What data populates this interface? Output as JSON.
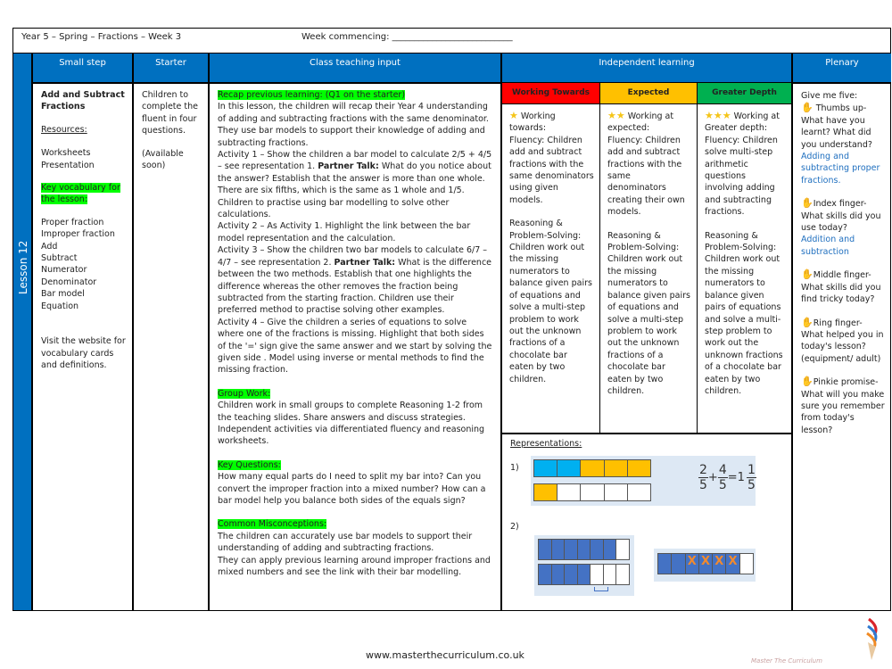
{
  "header": {
    "title": "Year 5 – Spring – Fractions – Week 3",
    "week_commencing": "Week commencing: ___________________________"
  },
  "lesson_label": "Lesson 12",
  "columns": [
    "Small step",
    "Starter",
    "Class teaching input",
    "Independent learning",
    "Plenary"
  ],
  "small_step": {
    "title": "Add and Subtract Fractions",
    "resources_label": "Resources:",
    "resources": [
      "Worksheets",
      "Presentation"
    ],
    "vocab_label": "Key vocabulary for the lesson:",
    "vocab": [
      "Proper fraction",
      "Improper fraction",
      "Add",
      "Subtract",
      "Numerator",
      "Denominator",
      "Bar model",
      "Equation"
    ],
    "website_note": "Visit the website for vocabulary cards and definitions."
  },
  "starter": {
    "text": "Children to complete the fluent in four questions.",
    "availability": "(Available soon)"
  },
  "teaching": {
    "recap_label": "Recap previous learning: (Q1 on the starter)",
    "intro": "In this lesson, the children will recap their Year 4 understanding of adding and subtracting fractions with the same denominator. They use bar models to support their knowledge of adding and subtracting fractions.",
    "activity1_a": "Activity 1 – Show the children a bar model to calculate 2/5 + 4/5 – see representation 1. ",
    "partner_talk": "Partner Talk:",
    "activity1_b": " What do you notice about the answer? Establish that the answer is more than one whole. There are six fifths, which is the same as 1 whole and 1/5. Children to practise using bar modelling to solve other calculations.",
    "activity2": "Activity 2 – As Activity 1. Highlight the link between the bar model representation and the calculation.",
    "activity3_a": "Activity 3 – Show the children two bar models to calculate 6/7 – 4/7 – see representation 2. ",
    "activity3_b": " What is the difference between the two methods. Establish that one highlights the difference whereas the other removes the fraction being subtracted from the starting fraction. Children use their preferred method to practise solving other examples.",
    "activity4": "Activity 4 – Give the children a series of equations to solve where one of the fractions is missing. Highlight that both sides of the '=' sign give the same answer and we start by solving the given side . Model using inverse or mental methods to find the missing fraction.",
    "group_label": "Group Work:",
    "group_text": "Children work in small groups to complete Reasoning 1-2 from the teaching slides. Share answers and discuss strategies. Independent activities via differentiated fluency and reasoning worksheets.",
    "questions_label": "Key Questions:",
    "questions_text": "How many equal parts do I need to split my bar into? Can you convert the improper fraction into a mixed number? How can a bar model help you balance both sides of the equals sign?",
    "misconceptions_label": "Common Misconceptions:",
    "misconceptions_1": "The children can accurately use bar models to support their understanding of adding and subtracting fractions.",
    "misconceptions_2": "They can apply previous learning around improper fractions and mixed numbers and see the link with their bar modelling."
  },
  "independent": {
    "levels": [
      {
        "label": "Working Towards",
        "color": "#ff0000",
        "stars": "★",
        "heading": "Working towards:",
        "fluency": "Fluency: Children add and subtract fractions with the same denominators using given models.",
        "reasoning": "Reasoning & Problem-Solving: Children work out the missing numerators to balance given pairs of equations and solve a multi-step problem to work out the unknown fractions of a chocolate bar eaten by two children."
      },
      {
        "label": "Expected",
        "color": "#ffc000",
        "stars": "★★",
        "heading": "Working at expected:",
        "fluency": "Fluency: Children add and subtract fractions with the same denominators creating their own models.",
        "reasoning": "Reasoning & Problem-Solving: Children work out the missing numerators to balance given pairs of equations and solve a multi-step problem to work out the unknown fractions of a chocolate bar eaten by two children."
      },
      {
        "label": "Greater Depth",
        "color": "#00b050",
        "stars": "★★★",
        "heading": "Working at Greater depth:",
        "fluency": "Fluency: Children solve multi-step arithmetic questions involving adding and subtracting fractions.",
        "reasoning": "Reasoning & Problem-Solving: Children work out the missing numerators to balance given pairs of equations and solve a multi-step problem to work out the unknown fractions of a chocolate bar eaten by two children."
      }
    ],
    "representations_label": "Representations:",
    "rep1_label": "1)",
    "rep2_label": "2)",
    "equation": {
      "a_num": "2",
      "a_den": "5",
      "plus": "+",
      "b_num": "4",
      "b_den": "5",
      "eq": "=",
      "whole": "1",
      "c_num": "1",
      "c_den": "5"
    },
    "cross": "X"
  },
  "plenary": {
    "intro": "Give me five:",
    "items": [
      {
        "title": "Thumbs up-",
        "question": "What have you learnt? What did you understand?",
        "answer": "Adding and subtracting proper fractions."
      },
      {
        "title": "Index finger-",
        "question": "What skills did you use today?",
        "answer": "Addition and subtraction"
      },
      {
        "title": "Middle finger-",
        "question": "What skills did you find tricky today?",
        "answer": ""
      },
      {
        "title": "Ring finger-",
        "question": "What helped you in today's lesson? (equipment/ adult)",
        "answer": ""
      },
      {
        "title": "Pinkie promise-",
        "question": "What will you make sure you remember from today's lesson?",
        "answer": ""
      }
    ]
  },
  "footer": {
    "url": "www.masterthecurriculum.co.uk",
    "brand": "Master The Curriculum"
  },
  "colors": {
    "header_blue": "#0070c0",
    "highlight": "#00ff00",
    "bar_blue": "#00b0f0",
    "bar_orange": "#ffc000",
    "bar_dark_blue": "#4472c4",
    "cross_orange": "#f28a2e"
  }
}
